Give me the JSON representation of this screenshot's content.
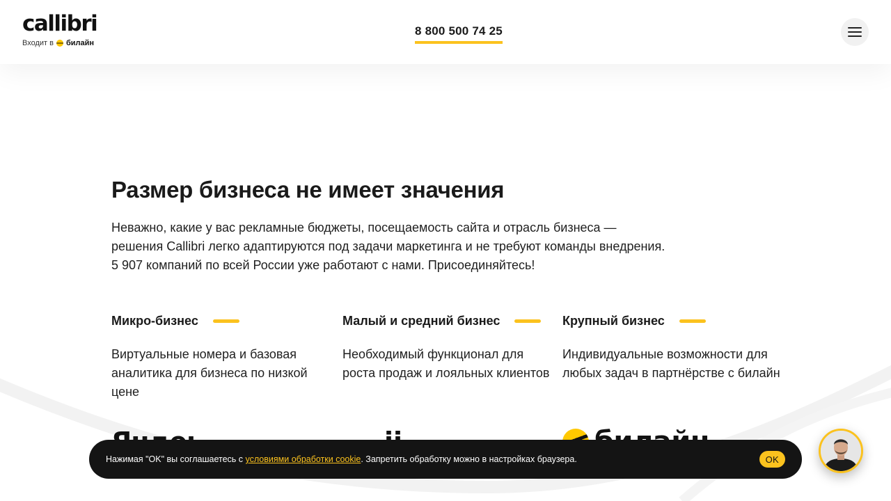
{
  "header": {
    "logo_text": "callibri",
    "logo_sub_prefix": "Входит в",
    "logo_sub_brand": "билайн",
    "phone": "8 800 500 74 25"
  },
  "main": {
    "title": "Размер бизнеса не имеет значения",
    "description": "Неважно, какие у вас рекламные бюджеты, посещаемость сайта и отрасль бизнеса — решения Callibri легко адаптируются под задачи маркетинга и не требуют команды внедрения. 5 907 компаний по всей России уже работают с нами. Присоединяйтесь!",
    "columns": [
      {
        "title": "Микро-бизнес",
        "text": "Виртуальные номера и базовая аналитика для бизнеса по низкой цене"
      },
      {
        "title": "Малый и средний бизнес",
        "text": "Необходимый функционал для роста продаж и лояльных клиентов"
      },
      {
        "title": "Крупный бизнес",
        "text": "Индивидуальные возможности для любых задач в партнёрстве с билайн"
      }
    ],
    "partners": [
      "Яндекс",
      "ii",
      "билайн"
    ]
  },
  "cookie": {
    "text_before": "Нажимая \"OK\" вы соглашаетесь с ",
    "link_text": "условиями обработки cookie",
    "text_after": ". Запретить обработку можно в настройках браузера.",
    "ok_label": "OK"
  },
  "icons": {
    "menu": "hamburger-menu-icon",
    "chat": "chat-operator-avatar"
  },
  "colors": {
    "accent": "#fbc21e",
    "dark": "#141414",
    "text": "#1a1a1a"
  }
}
